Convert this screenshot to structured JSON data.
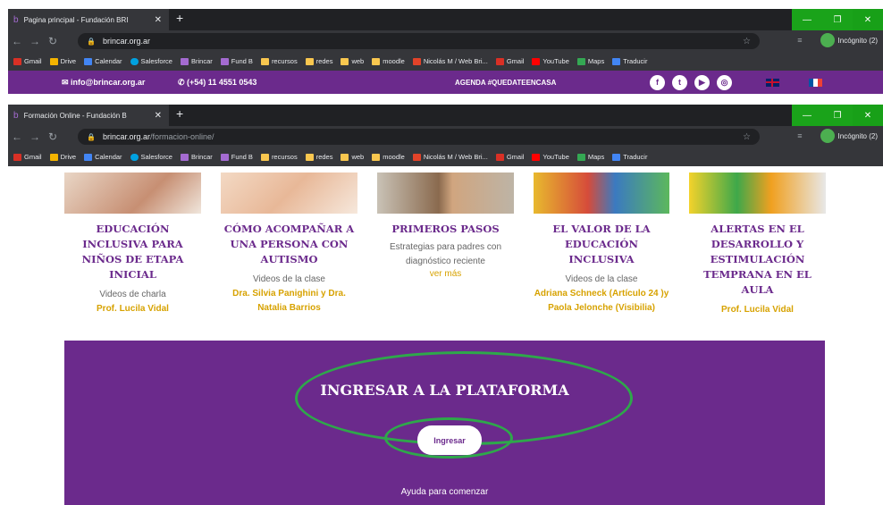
{
  "window1": {
    "tab_title": "Pagina principal - Fundación BRI",
    "url_host": "brincar.org.ar",
    "url_path": "",
    "incognito": "Incógnito (2)"
  },
  "bookmarks": [
    "Gmail",
    "Drive",
    "Calendar",
    "Salesforce",
    "Brincar",
    "Fund B",
    "recursos",
    "redes",
    "web",
    "moodle",
    "Nicolás M / Web Bri...",
    "Gmail",
    "YouTube",
    "Maps",
    "Traducir"
  ],
  "sitebar": {
    "email": "info@brincar.org.ar",
    "phone": "(+54) 11 4551 0543",
    "agenda": "AGENDA #QUEDATEENCASA"
  },
  "window2": {
    "tab_title": "Formación Online - Fundación B",
    "url_host": "brincar.org.ar",
    "url_path": "/formacion-online/",
    "incognito": "Incógnito (2)"
  },
  "cards": [
    {
      "title": "EDUCACIÓN INCLUSIVA PARA NIÑOS DE ETAPA INICIAL",
      "subtitle": "Videos de charla",
      "author": "Prof. Lucila Vidal"
    },
    {
      "title": "CÓMO ACOMPAÑAR A UNA PERSONA CON AUTISMO",
      "subtitle": "Videos de la clase",
      "author": "Dra. Silvia Panighini y Dra. Natalia Barrios"
    },
    {
      "title": "PRIMEROS PASOS",
      "subtitle": "Estrategias para padres con diagnóstico reciente",
      "author": "ver más"
    },
    {
      "title": "EL VALOR DE LA EDUCACIÓN INCLUSIVA",
      "subtitle": "Videos de la clase",
      "author": "Adriana Schneck (Artículo 24 )y Paola Jelonche (Visibilia)"
    },
    {
      "title": "ALERTAS EN EL DESARROLLO Y ESTIMULACIÓN TEMPRANA EN EL AULA",
      "subtitle": "",
      "author": "Prof. Lucila Vidal"
    }
  ],
  "platform": {
    "heading": "INGRESAR A LA PLATAFORMA",
    "button": "Ingresar",
    "help": "Ayuda para comenzar"
  },
  "colors": {
    "brand": "#6b2a8c",
    "accent": "#d7a200",
    "highlight": "#2ea84a"
  }
}
